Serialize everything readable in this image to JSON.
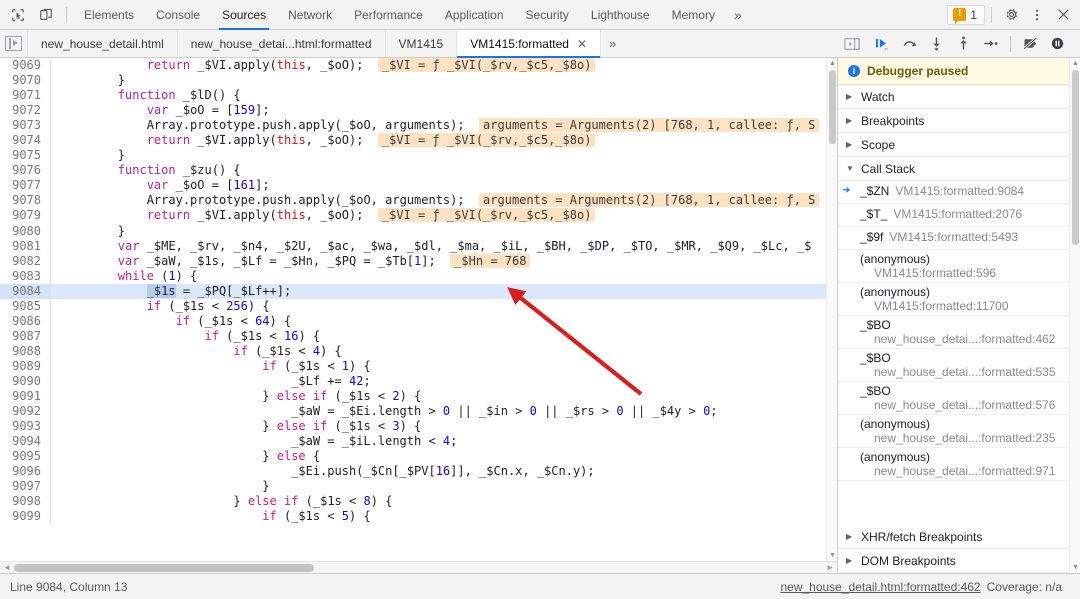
{
  "topbar": {
    "inspect_icon": "inspect-cursor-icon",
    "device_icon": "device-toolbar-icon",
    "tabs": [
      {
        "label": "Elements",
        "selected": false
      },
      {
        "label": "Console",
        "selected": false
      },
      {
        "label": "Sources",
        "selected": true
      },
      {
        "label": "Network",
        "selected": false
      },
      {
        "label": "Performance",
        "selected": false
      },
      {
        "label": "Application",
        "selected": false
      },
      {
        "label": "Security",
        "selected": false
      },
      {
        "label": "Lighthouse",
        "selected": false
      },
      {
        "label": "Memory",
        "selected": false
      }
    ],
    "overflow_label": "»",
    "warning_count": "1",
    "settings_icon": "gear-icon",
    "more_icon": "kebab-menu-icon",
    "close_icon": "close-icon"
  },
  "filetabs": {
    "nav_toggle_icon": "show-navigator-icon",
    "items": [
      {
        "label": "new_house_detail.html",
        "active": false,
        "closable": false
      },
      {
        "label": "new_house_detai...html:formatted",
        "active": false,
        "closable": false
      },
      {
        "label": "VM1415",
        "active": false,
        "closable": false
      },
      {
        "label": "VM1415:formatted",
        "active": true,
        "closable": true
      }
    ],
    "close_glyph": "✕",
    "overflow_label": "»",
    "show_debugger_icon": "show-debugger-sidebar-icon",
    "controls": [
      {
        "name": "resume-script-execution-button",
        "icon": "resume-icon"
      },
      {
        "name": "step-over-button",
        "icon": "step-over-icon"
      },
      {
        "name": "step-into-button",
        "icon": "step-into-icon"
      },
      {
        "name": "step-out-button",
        "icon": "step-out-icon"
      },
      {
        "name": "step-button",
        "icon": "step-icon"
      },
      {
        "name": "deactivate-breakpoints-button",
        "icon": "deactivate-breakpoints-icon"
      },
      {
        "name": "pause-on-exceptions-button",
        "icon": "pause-on-exceptions-icon"
      }
    ]
  },
  "editor": {
    "first_line_number": 9069,
    "highlighted_line": 9084,
    "lines": [
      {
        "n": "9069",
        "indent": 12,
        "tokens": [
          {
            "t": "return",
            "c": "kwm"
          },
          {
            "t": " _$VI.apply("
          },
          {
            "t": "this",
            "c": "kw"
          },
          {
            "t": ", _$oO);"
          }
        ],
        "hint": "_$VI = ƒ _$VI(_$rv,_$c5,_$8o)"
      },
      {
        "n": "9070",
        "indent": 8,
        "tokens": [
          {
            "t": "}"
          }
        ]
      },
      {
        "n": "9071",
        "indent": 8,
        "tokens": [
          {
            "t": "function",
            "c": "kwp"
          },
          {
            "t": " _$lD() {"
          }
        ]
      },
      {
        "n": "9072",
        "indent": 12,
        "tokens": [
          {
            "t": "var",
            "c": "kwp"
          },
          {
            "t": " _$oO = ["
          },
          {
            "t": "159",
            "c": "num"
          },
          {
            "t": "];"
          }
        ]
      },
      {
        "n": "9073",
        "indent": 12,
        "tokens": [
          {
            "t": "Array.prototype.push.apply(_$oO, arguments);"
          }
        ],
        "hint": "arguments = Arguments(2) [768, 1, callee: ƒ, S"
      },
      {
        "n": "9074",
        "indent": 12,
        "tokens": [
          {
            "t": "return",
            "c": "kwm"
          },
          {
            "t": " _$VI.apply("
          },
          {
            "t": "this",
            "c": "kw"
          },
          {
            "t": ", _$oO);"
          }
        ],
        "hint": "_$VI = ƒ _$VI(_$rv,_$c5,_$8o)"
      },
      {
        "n": "9075",
        "indent": 8,
        "tokens": [
          {
            "t": "}"
          }
        ]
      },
      {
        "n": "9076",
        "indent": 8,
        "tokens": [
          {
            "t": "function",
            "c": "kwp"
          },
          {
            "t": " _$zu() {"
          }
        ]
      },
      {
        "n": "9077",
        "indent": 12,
        "tokens": [
          {
            "t": "var",
            "c": "kwp"
          },
          {
            "t": " _$oO = ["
          },
          {
            "t": "161",
            "c": "num"
          },
          {
            "t": "];"
          }
        ]
      },
      {
        "n": "9078",
        "indent": 12,
        "tokens": [
          {
            "t": "Array.prototype.push.apply(_$oO, arguments);"
          }
        ],
        "hint": "arguments = Arguments(2) [768, 1, callee: ƒ, S"
      },
      {
        "n": "9079",
        "indent": 12,
        "tokens": [
          {
            "t": "return",
            "c": "kwm"
          },
          {
            "t": " _$VI.apply("
          },
          {
            "t": "this",
            "c": "kw"
          },
          {
            "t": ", _$oO);"
          }
        ],
        "hint": "_$VI = ƒ _$VI(_$rv,_$c5,_$8o)"
      },
      {
        "n": "9080",
        "indent": 8,
        "tokens": [
          {
            "t": "}"
          }
        ]
      },
      {
        "n": "9081",
        "indent": 8,
        "tokens": [
          {
            "t": "var",
            "c": "kwp"
          },
          {
            "t": " _$ME, _$rv, _$n4, _$2U, _$ac, _$wa, _$dl, _$ma, _$iL, _$BH, _$DP, _$TO, _$MR, _$Q9, _$Lc, _$"
          }
        ]
      },
      {
        "n": "9082",
        "indent": 8,
        "tokens": [
          {
            "t": "var",
            "c": "kwp"
          },
          {
            "t": " _$aW, _$1s, _$Lf = _$Hn, _$PQ = _$Tb["
          },
          {
            "t": "1",
            "c": "num"
          },
          {
            "t": "];"
          }
        ],
        "hint": "_$Hn = 768"
      },
      {
        "n": "9083",
        "indent": 8,
        "tokens": [
          {
            "t": "while",
            "c": "kwm"
          },
          {
            "t": " ("
          },
          {
            "t": "1",
            "c": "num"
          },
          {
            "t": ") {"
          }
        ]
      },
      {
        "n": "9084",
        "indent": 12,
        "tokens": [
          {
            "t": "_$1s",
            "c": "sel"
          },
          {
            "t": " = _$PQ[_$Lf++];"
          }
        ],
        "highlight": true
      },
      {
        "n": "9085",
        "indent": 12,
        "tokens": [
          {
            "t": "if",
            "c": "kwm"
          },
          {
            "t": " (_$1s < "
          },
          {
            "t": "256",
            "c": "num"
          },
          {
            "t": ") {"
          }
        ]
      },
      {
        "n": "9086",
        "indent": 16,
        "tokens": [
          {
            "t": "if",
            "c": "kwm"
          },
          {
            "t": " (_$1s < "
          },
          {
            "t": "64",
            "c": "num"
          },
          {
            "t": ") {"
          }
        ]
      },
      {
        "n": "9087",
        "indent": 20,
        "tokens": [
          {
            "t": "if",
            "c": "kwm"
          },
          {
            "t": " (_$1s < "
          },
          {
            "t": "16",
            "c": "num"
          },
          {
            "t": ") {"
          }
        ]
      },
      {
        "n": "9088",
        "indent": 24,
        "tokens": [
          {
            "t": "if",
            "c": "kwm"
          },
          {
            "t": " (_$1s < "
          },
          {
            "t": "4",
            "c": "num"
          },
          {
            "t": ") {"
          }
        ]
      },
      {
        "n": "9089",
        "indent": 28,
        "tokens": [
          {
            "t": "if",
            "c": "kwm"
          },
          {
            "t": " (_$1s < "
          },
          {
            "t": "1",
            "c": "num"
          },
          {
            "t": ") {"
          }
        ]
      },
      {
        "n": "9090",
        "indent": 32,
        "tokens": [
          {
            "t": "_$Lf += "
          },
          {
            "t": "42",
            "c": "num"
          },
          {
            "t": ";"
          }
        ]
      },
      {
        "n": "9091",
        "indent": 28,
        "tokens": [
          {
            "t": "} "
          },
          {
            "t": "else if",
            "c": "kwm"
          },
          {
            "t": " (_$1s < "
          },
          {
            "t": "2",
            "c": "num"
          },
          {
            "t": ") {"
          }
        ]
      },
      {
        "n": "9092",
        "indent": 32,
        "tokens": [
          {
            "t": "_$aW = _$Ei.length > "
          },
          {
            "t": "0",
            "c": "num"
          },
          {
            "t": " || _$in > "
          },
          {
            "t": "0",
            "c": "num"
          },
          {
            "t": " || _$rs > "
          },
          {
            "t": "0",
            "c": "num"
          },
          {
            "t": " || _$4y > "
          },
          {
            "t": "0",
            "c": "num"
          },
          {
            "t": ";"
          }
        ]
      },
      {
        "n": "9093",
        "indent": 28,
        "tokens": [
          {
            "t": "} "
          },
          {
            "t": "else if",
            "c": "kwm"
          },
          {
            "t": " (_$1s < "
          },
          {
            "t": "3",
            "c": "num"
          },
          {
            "t": ") {"
          }
        ]
      },
      {
        "n": "9094",
        "indent": 32,
        "tokens": [
          {
            "t": "_$aW = _$iL.length < "
          },
          {
            "t": "4",
            "c": "num"
          },
          {
            "t": ";"
          }
        ]
      },
      {
        "n": "9095",
        "indent": 28,
        "tokens": [
          {
            "t": "} "
          },
          {
            "t": "else",
            "c": "kwm"
          },
          {
            "t": " {"
          }
        ]
      },
      {
        "n": "9096",
        "indent": 32,
        "tokens": [
          {
            "t": "_$Ei.push(_$Cn[_$PV["
          },
          {
            "t": "16",
            "c": "num"
          },
          {
            "t": "]], _$Cn.x, _$Cn.y);"
          }
        ]
      },
      {
        "n": "9097",
        "indent": 28,
        "tokens": [
          {
            "t": "}"
          }
        ]
      },
      {
        "n": "9098",
        "indent": 24,
        "tokens": [
          {
            "t": "} "
          },
          {
            "t": "else if",
            "c": "kwm"
          },
          {
            "t": " (_$1s < "
          },
          {
            "t": "8",
            "c": "num"
          },
          {
            "t": ") {"
          }
        ]
      },
      {
        "n": "9099",
        "indent": 28,
        "tokens": [
          {
            "t": "if",
            "c": "kwm"
          },
          {
            "t": " (_$1s < "
          },
          {
            "t": "5",
            "c": "num"
          },
          {
            "t": ") {"
          }
        ]
      }
    ]
  },
  "sidebar": {
    "paused_text": "Debugger paused",
    "sections": [
      {
        "label": "Watch",
        "expanded": false
      },
      {
        "label": "Breakpoints",
        "expanded": false
      },
      {
        "label": "Scope",
        "expanded": false
      },
      {
        "label": "Call Stack",
        "expanded": true
      }
    ],
    "call_stack": [
      {
        "fn": "_$ZN",
        "loc": "VM1415:formatted:9084",
        "active": true,
        "two_line": false
      },
      {
        "fn": "_$T_",
        "loc": "VM1415:formatted:2076",
        "active": false,
        "two_line": false
      },
      {
        "fn": "_$9f",
        "loc": "VM1415:formatted:5493",
        "active": false,
        "two_line": false
      },
      {
        "fn": "(anonymous)",
        "loc": "VM1415:formatted:596",
        "active": false,
        "two_line": true
      },
      {
        "fn": "(anonymous)",
        "loc": "VM1415:formatted:11700",
        "active": false,
        "two_line": true
      },
      {
        "fn": "_$BO",
        "loc": "new_house_detai...:formatted:462",
        "active": false,
        "two_line": true
      },
      {
        "fn": "_$BO",
        "loc": "new_house_detai...:formatted:535",
        "active": false,
        "two_line": true
      },
      {
        "fn": "_$BO",
        "loc": "new_house_detai...:formatted:576",
        "active": false,
        "two_line": true
      },
      {
        "fn": "(anonymous)",
        "loc": "new_house_detai...:formatted:235",
        "active": false,
        "two_line": true
      },
      {
        "fn": "(anonymous)",
        "loc": "new_house_detai...:formatted:971",
        "active": false,
        "two_line": true
      }
    ],
    "bottom_sections": [
      {
        "label": "XHR/fetch Breakpoints",
        "expanded": false
      },
      {
        "label": "DOM Breakpoints",
        "expanded": false
      }
    ]
  },
  "statusbar": {
    "position": "Line 9084, Column 13",
    "source_link": "new_house_detail.html:formatted:462",
    "coverage": "Coverage: n/a"
  },
  "annotation": {
    "arrow_color": "#d62020",
    "points_to": "_$Hn = 768"
  },
  "colors": {
    "accent": "#1a73e8",
    "paused_bg": "#fdf9e2",
    "hint_bg": "#ffe2c2",
    "highlight_line": "#dbe8fb",
    "warning": "#f29900"
  }
}
